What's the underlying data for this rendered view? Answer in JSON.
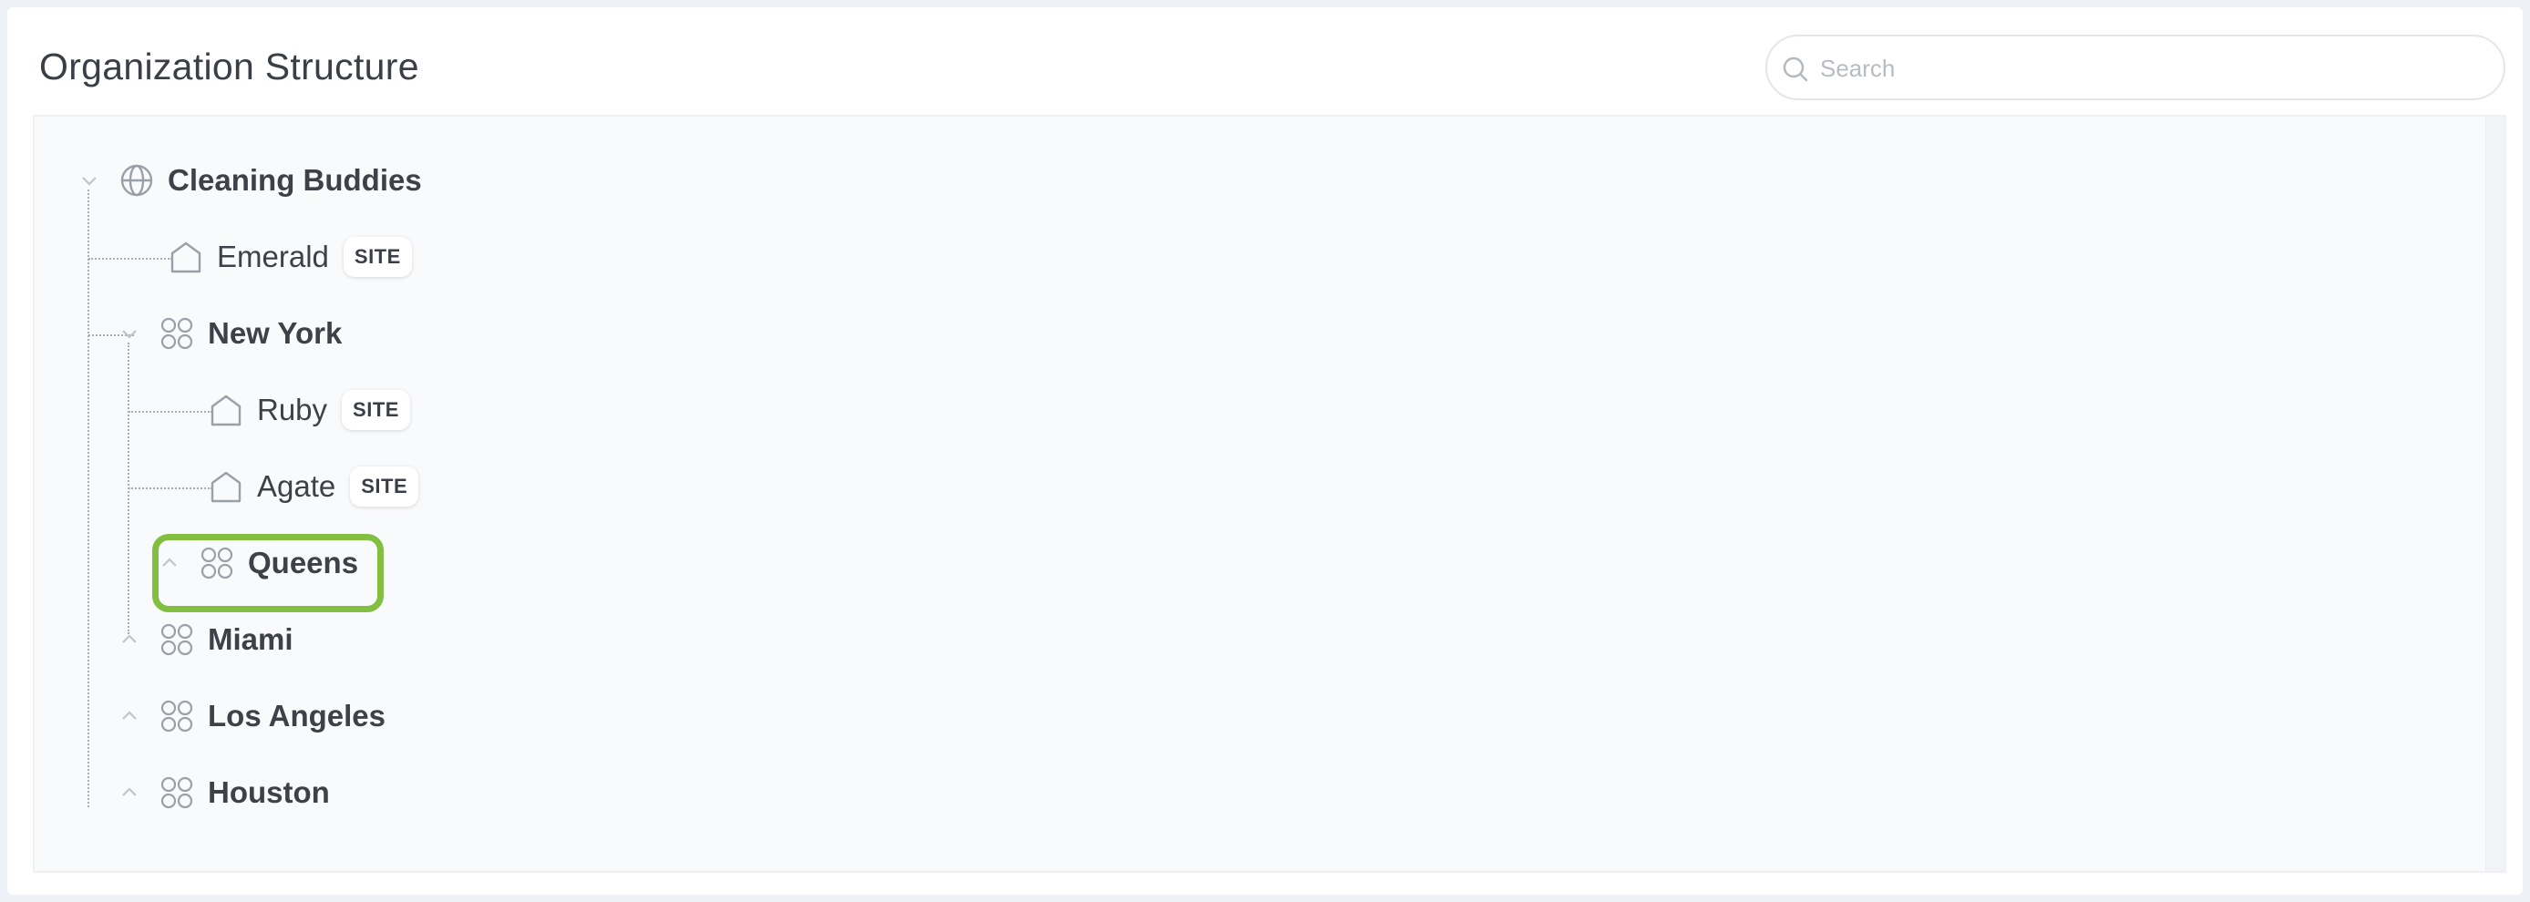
{
  "header": {
    "title": "Organization Structure",
    "search_placeholder": "Search"
  },
  "tree": {
    "root": {
      "label": "Cleaning Buddies",
      "icon": "globe-icon",
      "state": "expanded"
    },
    "items": [
      {
        "label": "Emerald",
        "badge": "SITE",
        "icon": "house-icon"
      },
      {
        "label": "New York",
        "icon": "group-icon",
        "state": "expanded"
      },
      {
        "label": "Ruby",
        "badge": "SITE",
        "icon": "house-icon"
      },
      {
        "label": "Agate",
        "badge": "SITE",
        "icon": "house-icon"
      },
      {
        "label": "Queens",
        "icon": "group-icon",
        "state": "collapsed",
        "highlighted": true
      },
      {
        "label": "Miami",
        "icon": "group-icon",
        "state": "collapsed"
      },
      {
        "label": "Los Angeles",
        "icon": "group-icon",
        "state": "collapsed"
      },
      {
        "label": "Houston",
        "icon": "group-icon",
        "state": "collapsed"
      }
    ]
  },
  "colors": {
    "highlight": "#82bf41",
    "tree_lines": "#a9adb4",
    "icon_gray": "#9aa0a8"
  }
}
